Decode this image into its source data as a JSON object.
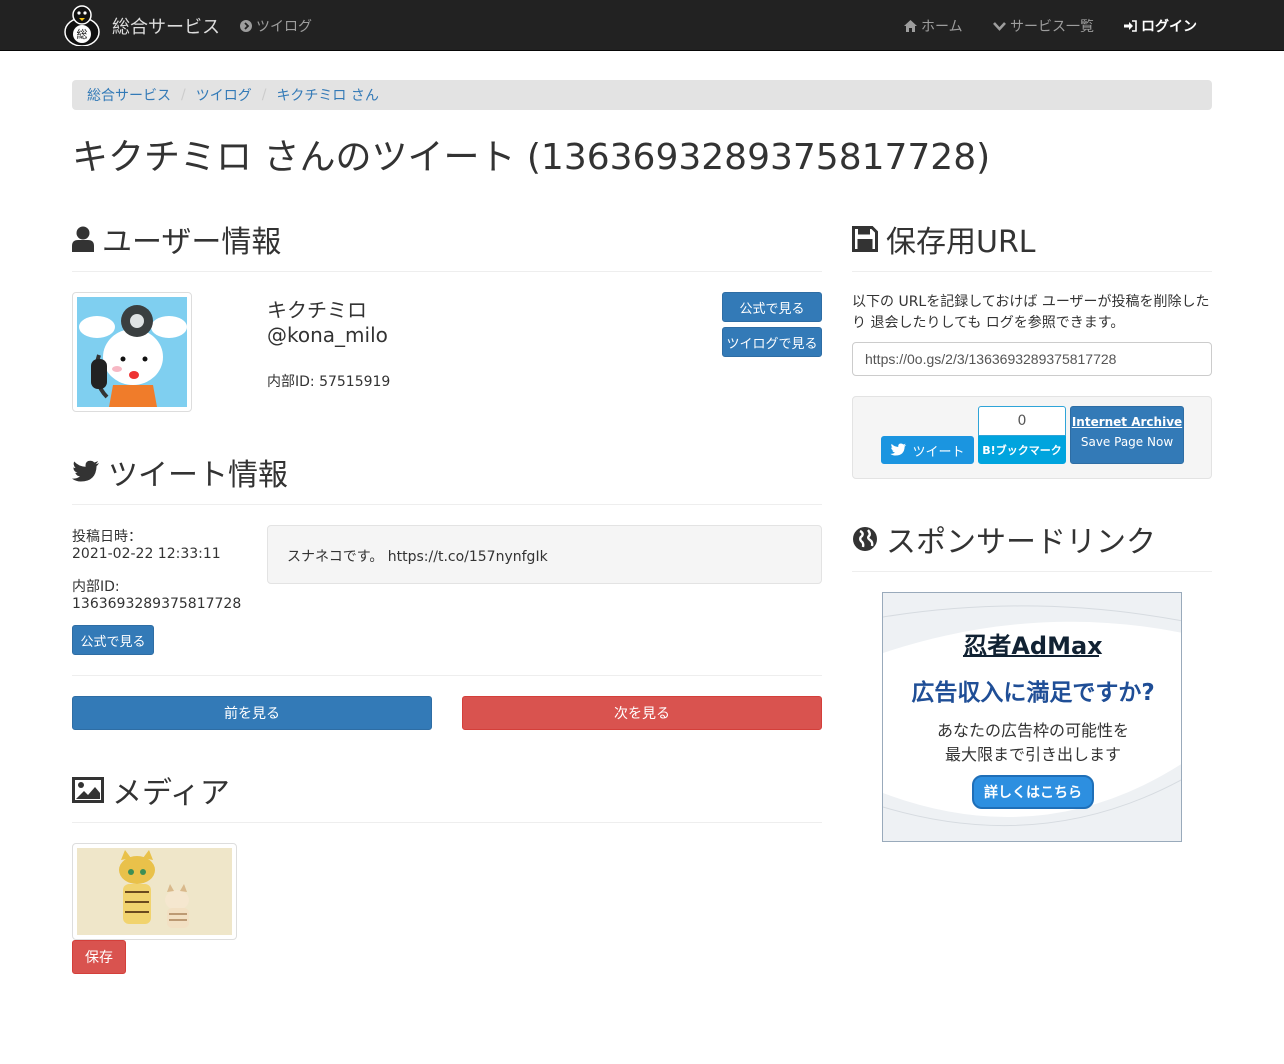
{
  "navbar": {
    "brand": "総合サービス",
    "tweet_log": "ツイログ",
    "home": "ホーム",
    "services": "サービス一覧",
    "login": "ログイン"
  },
  "breadcrumb": [
    "総合サービス",
    "ツイログ",
    "キクチミロ さん"
  ],
  "page_title": "キクチミロ さんのツイート (1363693289375817728)",
  "user_info": {
    "heading": "ユーザー情報",
    "display_name": "キクチミロ",
    "screen_name": "@kona_milo",
    "internal_id": "内部ID: 57515919",
    "btn_official": "公式で見る",
    "btn_tweetlog": "ツイログで見る"
  },
  "tweet_info": {
    "heading": "ツイート情報",
    "posted_label": "投稿日時：",
    "posted_value": "2021-02-22 12:33:11",
    "id_label": "内部ID:",
    "id_value": "1363693289375817728",
    "btn_official": "公式で見る",
    "text": "スナネコです。 https://t.co/157nynfgIk"
  },
  "pager": {
    "prev": "前を見る",
    "next": "次を見る"
  },
  "media": {
    "heading": "メディア",
    "save": "保存"
  },
  "save_url": {
    "heading": "保存用URL",
    "description": "以下の URLを記録しておけば ユーザーが投稿を削除したり 退会したりしても ログを参照できます。",
    "url": "https://0o.gs/2/3/1363693289375817728",
    "tweet_btn": "ツイート",
    "bookmark_count": "0",
    "bookmark_label": "B!ブックマーク",
    "archive_title": "Internet Archive",
    "archive_sub": "Save Page Now"
  },
  "sponsor": {
    "heading": "スポンサードリンク",
    "ad_brand": "忍者AdMax",
    "ad_headline": "広告収入に満足ですか?",
    "ad_line1": "あなたの広告枠の可能性を",
    "ad_line2": "最大限まで引き出します",
    "ad_button": "詳しくはこちら"
  },
  "colors": {
    "primary": "#337ab7",
    "danger": "#d9534f",
    "navbar": "#222222",
    "twitter": "#1b95e0",
    "hatena": "#00a4de"
  }
}
